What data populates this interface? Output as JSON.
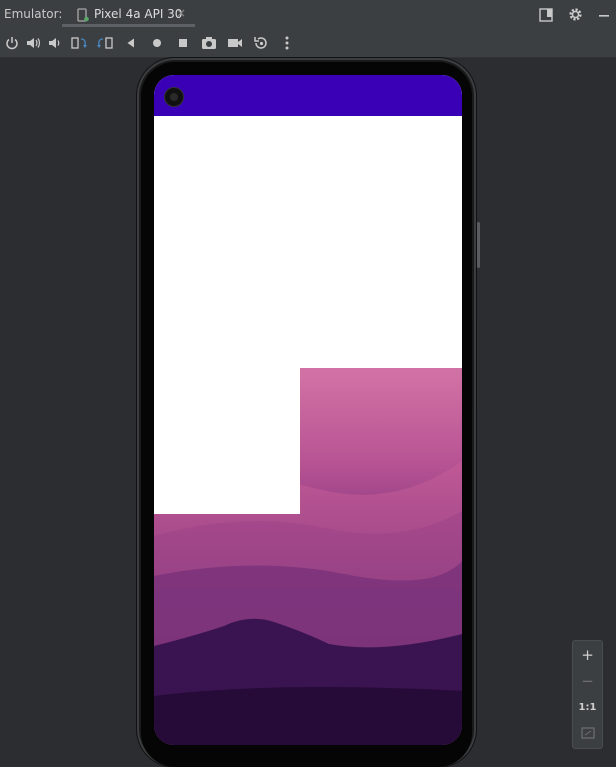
{
  "header": {
    "emulator_label": "Emulator:",
    "tab": {
      "label": "Pixel 4a API 30",
      "close": "×"
    }
  },
  "right_tools": {
    "icons": [
      "layout-icon",
      "gear-icon",
      "minimize-icon"
    ]
  },
  "toolbar": {
    "icons": [
      "power-icon",
      "volume-up-icon",
      "volume-down-icon",
      "rotate-left-icon",
      "rotate-right-icon",
      "back-icon",
      "home-icon",
      "overview-icon",
      "screenshot-icon",
      "record-icon",
      "snapshot-icon",
      "more-icon"
    ]
  },
  "device": {
    "status_bar_color": "#3a00b6"
  },
  "zoom": {
    "plus": "+",
    "minus": "−",
    "one_to_one": "1:1"
  }
}
